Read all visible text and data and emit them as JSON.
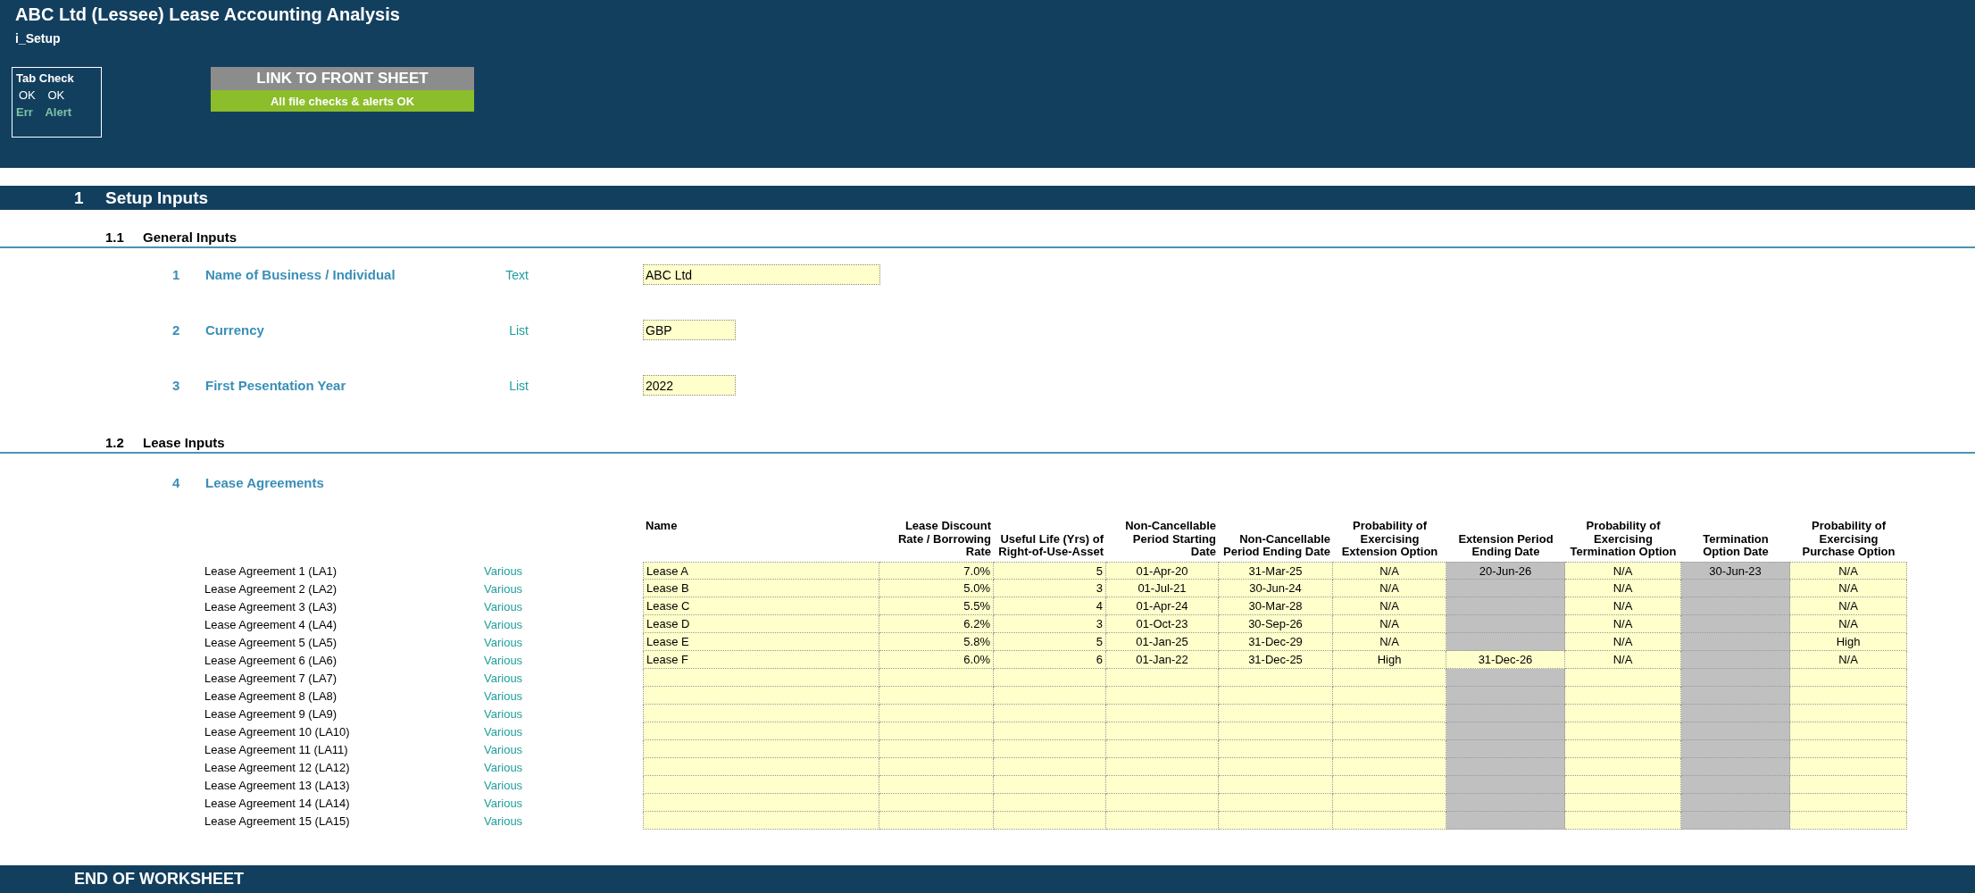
{
  "header": {
    "title": "ABC Ltd (Lessee) Lease Accounting Analysis",
    "sheet": "i_Setup",
    "tab_check": {
      "title": "Tab Check",
      "values": [
        "OK",
        "OK"
      ],
      "labels": [
        "Err",
        "Alert"
      ]
    },
    "link_button": "LINK TO FRONT SHEET",
    "status": "All file checks & alerts OK"
  },
  "section": {
    "number": "1",
    "title": "Setup Inputs"
  },
  "general": {
    "number": "1.1",
    "title": "General Inputs",
    "inputs": [
      {
        "number": "1",
        "label": "Name of Business / Individual",
        "type": "Text",
        "value": "ABC Ltd",
        "kind": "wide"
      },
      {
        "number": "2",
        "label": "Currency",
        "type": "List",
        "value": "GBP",
        "kind": "narrow"
      },
      {
        "number": "3",
        "label": "First Pesentation Year",
        "type": "List",
        "value": "2022",
        "kind": "narrow"
      }
    ]
  },
  "lease": {
    "number": "1.2",
    "title": "Lease Inputs",
    "item_number": "4",
    "item_label": "Lease Agreements",
    "table": {
      "columns": [
        "Name",
        "Lease Discount Rate / Borrowing Rate",
        "Useful Life (Yrs) of Right-of-Use-Asset",
        "Non-Cancellable Period Starting Date",
        "Non-Cancellable Period Ending Date",
        "Probability of Exercising Extension Option",
        "Extension Period Ending Date",
        "Probability of Exercising Termination Option",
        "Termination Option Date",
        "Probability of Exercising Purchase Option"
      ],
      "rows": [
        {
          "label": "Lease Agreement 1 (LA1)",
          "type": "Various",
          "cells": [
            {
              "value": "Lease A",
              "disabled": false
            },
            {
              "value": "7.0%",
              "disabled": false
            },
            {
              "value": "5",
              "disabled": false
            },
            {
              "value": "01-Apr-20",
              "disabled": false
            },
            {
              "value": "31-Mar-25",
              "disabled": false
            },
            {
              "value": "N/A",
              "disabled": false
            },
            {
              "value": "20-Jun-26",
              "disabled": true
            },
            {
              "value": "N/A",
              "disabled": false
            },
            {
              "value": "30-Jun-23",
              "disabled": true
            },
            {
              "value": "N/A",
              "disabled": false
            }
          ]
        },
        {
          "label": "Lease Agreement 2 (LA2)",
          "type": "Various",
          "cells": [
            {
              "value": "Lease B",
              "disabled": false
            },
            {
              "value": "5.0%",
              "disabled": false
            },
            {
              "value": "3",
              "disabled": false
            },
            {
              "value": "01-Jul-21",
              "disabled": false
            },
            {
              "value": "30-Jun-24",
              "disabled": false
            },
            {
              "value": "N/A",
              "disabled": false
            },
            {
              "disabled": true
            },
            {
              "value": "N/A",
              "disabled": false
            },
            {
              "disabled": true
            },
            {
              "value": "N/A",
              "disabled": false
            }
          ]
        },
        {
          "label": "Lease Agreement 3 (LA3)",
          "type": "Various",
          "cells": [
            {
              "value": "Lease C",
              "disabled": false
            },
            {
              "value": "5.5%",
              "disabled": false
            },
            {
              "value": "4",
              "disabled": false
            },
            {
              "value": "01-Apr-24",
              "disabled": false
            },
            {
              "value": "30-Mar-28",
              "disabled": false
            },
            {
              "value": "N/A",
              "disabled": false
            },
            {
              "disabled": true
            },
            {
              "value": "N/A",
              "disabled": false
            },
            {
              "disabled": true
            },
            {
              "value": "N/A",
              "disabled": false
            }
          ]
        },
        {
          "label": "Lease Agreement 4 (LA4)",
          "type": "Various",
          "cells": [
            {
              "value": "Lease D",
              "disabled": false
            },
            {
              "value": "6.2%",
              "disabled": false
            },
            {
              "value": "3",
              "disabled": false
            },
            {
              "value": "01-Oct-23",
              "disabled": false
            },
            {
              "value": "30-Sep-26",
              "disabled": false
            },
            {
              "value": "N/A",
              "disabled": false
            },
            {
              "disabled": true
            },
            {
              "value": "N/A",
              "disabled": false
            },
            {
              "disabled": true
            },
            {
              "value": "N/A",
              "disabled": false
            }
          ]
        },
        {
          "label": "Lease Agreement 5 (LA5)",
          "type": "Various",
          "cells": [
            {
              "value": "Lease E",
              "disabled": false
            },
            {
              "value": "5.8%",
              "disabled": false
            },
            {
              "value": "5",
              "disabled": false
            },
            {
              "value": "01-Jan-25",
              "disabled": false
            },
            {
              "value": "31-Dec-29",
              "disabled": false
            },
            {
              "value": "N/A",
              "disabled": false
            },
            {
              "disabled": true
            },
            {
              "value": "N/A",
              "disabled": false
            },
            {
              "disabled": true
            },
            {
              "value": "High",
              "disabled": false
            }
          ]
        },
        {
          "label": "Lease Agreement 6 (LA6)",
          "type": "Various",
          "cells": [
            {
              "value": "Lease F",
              "disabled": false
            },
            {
              "value": "6.0%",
              "disabled": false
            },
            {
              "value": "6",
              "disabled": false
            },
            {
              "value": "01-Jan-22",
              "disabled": false
            },
            {
              "value": "31-Dec-25",
              "disabled": false
            },
            {
              "value": "High",
              "disabled": false
            },
            {
              "value": "31-Dec-26",
              "disabled": false
            },
            {
              "value": "N/A",
              "disabled": false
            },
            {
              "disabled": true
            },
            {
              "value": "N/A",
              "disabled": false
            }
          ]
        },
        {
          "label": "Lease Agreement 7 (LA7)",
          "type": "Various",
          "cells": [
            {
              "disabled": false
            },
            {
              "disabled": false
            },
            {
              "disabled": false
            },
            {
              "disabled": false
            },
            {
              "disabled": false
            },
            {
              "disabled": false
            },
            {
              "disabled": true
            },
            {
              "disabled": false
            },
            {
              "disabled": true
            },
            {
              "disabled": false
            }
          ]
        },
        {
          "label": "Lease Agreement 8 (LA8)",
          "type": "Various",
          "cells": [
            {
              "disabled": false
            },
            {
              "disabled": false
            },
            {
              "disabled": false
            },
            {
              "disabled": false
            },
            {
              "disabled": false
            },
            {
              "disabled": false
            },
            {
              "disabled": true
            },
            {
              "disabled": false
            },
            {
              "disabled": true
            },
            {
              "disabled": false
            }
          ]
        },
        {
          "label": "Lease Agreement 9 (LA9)",
          "type": "Various",
          "cells": [
            {
              "disabled": false
            },
            {
              "disabled": false
            },
            {
              "disabled": false
            },
            {
              "disabled": false
            },
            {
              "disabled": false
            },
            {
              "disabled": false
            },
            {
              "disabled": true
            },
            {
              "disabled": false
            },
            {
              "disabled": true
            },
            {
              "disabled": false
            }
          ]
        },
        {
          "label": "Lease Agreement 10 (LA10)",
          "type": "Various",
          "cells": [
            {
              "disabled": false
            },
            {
              "disabled": false
            },
            {
              "disabled": false
            },
            {
              "disabled": false
            },
            {
              "disabled": false
            },
            {
              "disabled": false
            },
            {
              "disabled": true
            },
            {
              "disabled": false
            },
            {
              "disabled": true
            },
            {
              "disabled": false
            }
          ]
        },
        {
          "label": "Lease Agreement 11 (LA11)",
          "type": "Various",
          "cells": [
            {
              "disabled": false
            },
            {
              "disabled": false
            },
            {
              "disabled": false
            },
            {
              "disabled": false
            },
            {
              "disabled": false
            },
            {
              "disabled": false
            },
            {
              "disabled": true
            },
            {
              "disabled": false
            },
            {
              "disabled": true
            },
            {
              "disabled": false
            }
          ]
        },
        {
          "label": "Lease Agreement 12 (LA12)",
          "type": "Various",
          "cells": [
            {
              "disabled": false
            },
            {
              "disabled": false
            },
            {
              "disabled": false
            },
            {
              "disabled": false
            },
            {
              "disabled": false
            },
            {
              "disabled": false
            },
            {
              "disabled": true
            },
            {
              "disabled": false
            },
            {
              "disabled": true
            },
            {
              "disabled": false
            }
          ]
        },
        {
          "label": "Lease Agreement 13 (LA13)",
          "type": "Various",
          "cells": [
            {
              "disabled": false
            },
            {
              "disabled": false
            },
            {
              "disabled": false
            },
            {
              "disabled": false
            },
            {
              "disabled": false
            },
            {
              "disabled": false
            },
            {
              "disabled": true
            },
            {
              "disabled": false
            },
            {
              "disabled": true
            },
            {
              "disabled": false
            }
          ]
        },
        {
          "label": "Lease Agreement 14 (LA14)",
          "type": "Various",
          "cells": [
            {
              "disabled": false
            },
            {
              "disabled": false
            },
            {
              "disabled": false
            },
            {
              "disabled": false
            },
            {
              "disabled": false
            },
            {
              "disabled": false
            },
            {
              "disabled": true
            },
            {
              "disabled": false
            },
            {
              "disabled": true
            },
            {
              "disabled": false
            }
          ]
        },
        {
          "label": "Lease Agreement 15 (LA15)",
          "type": "Various",
          "cells": [
            {
              "disabled": false
            },
            {
              "disabled": false
            },
            {
              "disabled": false
            },
            {
              "disabled": false
            },
            {
              "disabled": false
            },
            {
              "disabled": false
            },
            {
              "disabled": true
            },
            {
              "disabled": false
            },
            {
              "disabled": true
            },
            {
              "disabled": false
            }
          ]
        }
      ]
    }
  },
  "footer": "END OF WORKSHEET"
}
